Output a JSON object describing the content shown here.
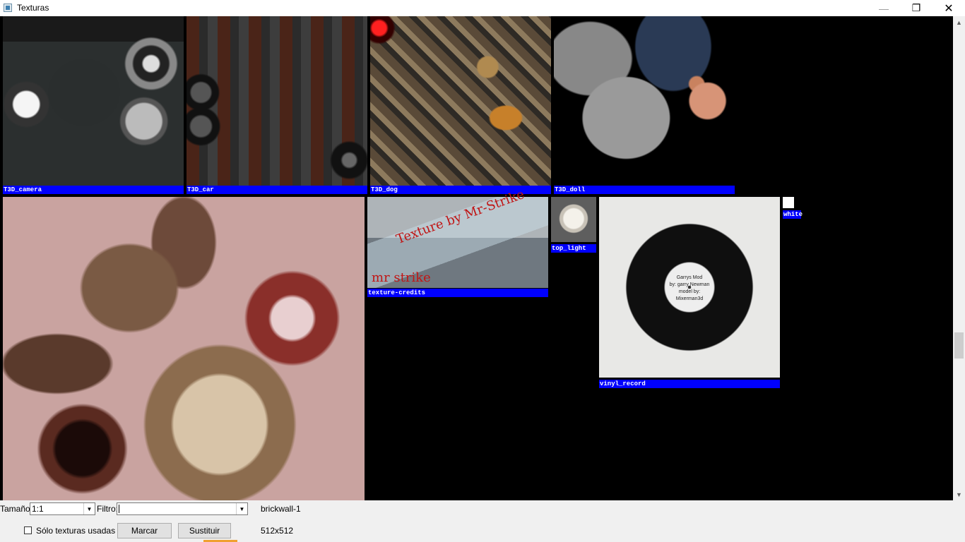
{
  "window": {
    "title": "Texturas",
    "minimize_glyph": "—",
    "maximize_glyph": "❐",
    "close_glyph": "✕"
  },
  "textures": [
    {
      "name": "T3D_camera"
    },
    {
      "name": "T3D_car"
    },
    {
      "name": "T3D_dog"
    },
    {
      "name": "T3D_doll"
    },
    {
      "name": "texture-credits",
      "overlay_text": "Texture by Mr-Strike",
      "signature": "mr strike"
    },
    {
      "name": "top_light"
    },
    {
      "name": "vinyl_record",
      "label_text": [
        "Garrys Mod",
        "by: garry Newman",
        "model by:",
        "Mixerman3d"
      ]
    },
    {
      "name": "white"
    }
  ],
  "controls": {
    "size_label": "Tamaño:",
    "size_value": "1:1",
    "filter_label": "Filtro:",
    "filter_value": "",
    "selected_texture": "brickwall-1",
    "only_used_label": "Sólo texturas usadas",
    "only_used_checked": false,
    "mark_button": "Marcar",
    "replace_button": "Sustituir",
    "texture_size": "512x512"
  },
  "icons": {
    "scroll_up": "▲",
    "scroll_down": "▼",
    "dropdown": "▼"
  },
  "colors": {
    "label_bg": "#0000ff",
    "viewport_bg": "#000000"
  }
}
